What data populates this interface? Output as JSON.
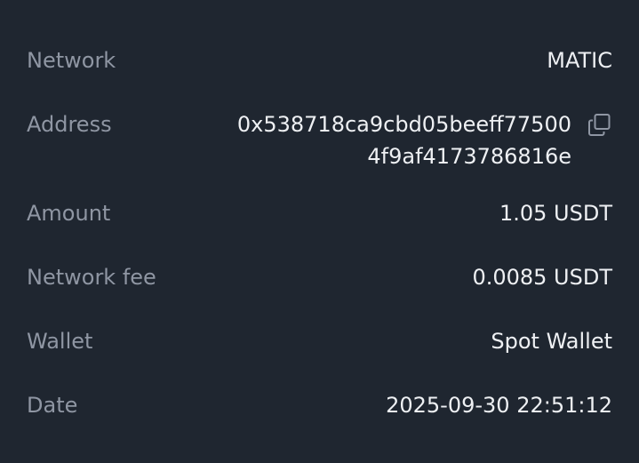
{
  "details": {
    "network": {
      "label": "Network",
      "value": "MATIC"
    },
    "address": {
      "label": "Address",
      "line1": "0x538718ca9cbd05beeff77500",
      "line2": "4f9af4173786816e",
      "copy_icon": "copy-icon"
    },
    "amount": {
      "label": "Amount",
      "value": "1.05 USDT"
    },
    "network_fee": {
      "label": "Network fee",
      "value": "0.0085 USDT"
    },
    "wallet": {
      "label": "Wallet",
      "value": "Spot Wallet"
    },
    "date": {
      "label": "Date",
      "value": "2025-09-30 22:51:12"
    }
  },
  "colors": {
    "background": "#1f2630",
    "label": "#8f96a3",
    "value": "#eef0f3",
    "icon": "#8f96a3"
  }
}
